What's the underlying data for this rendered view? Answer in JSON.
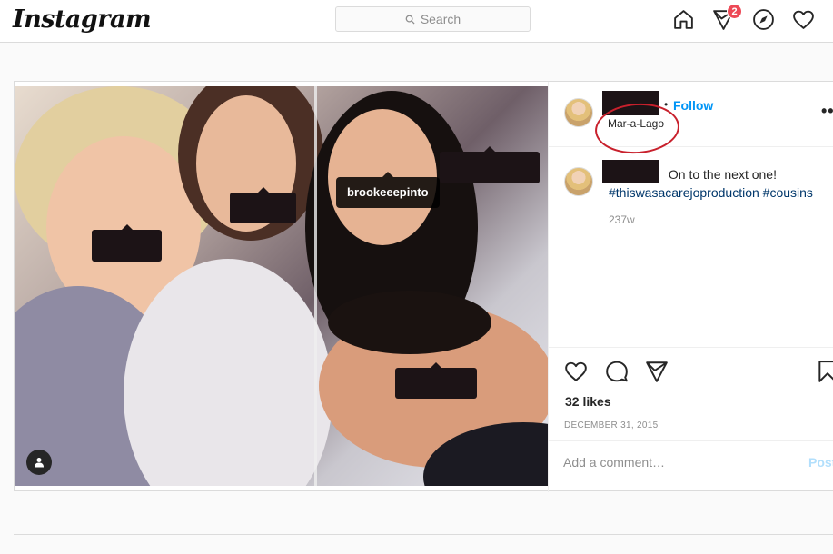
{
  "nav": {
    "logo": "Instagram",
    "search_placeholder": "Search",
    "notification_count": "2",
    "icons": [
      "home-icon",
      "direct-icon",
      "explore-icon",
      "activity-heart-icon"
    ]
  },
  "post": {
    "tagged_users": [
      {
        "label": "brookeeepinto"
      }
    ],
    "header": {
      "follow_label": "Follow",
      "separator": "•",
      "location": "Mar-a-Lago",
      "more_label": "•••"
    },
    "caption": {
      "text": "On to the next one!",
      "hashtags": "#thiswasacarejoproduction #cousins",
      "time_ago": "237w"
    },
    "likes": "32 likes",
    "date": "DECEMBER 31, 2015",
    "comment_placeholder": "Add a comment…",
    "post_button": "Post"
  },
  "colors": {
    "accent": "#0095f6",
    "hashtag": "#00376b",
    "badge": "#ed4956",
    "annotation_circle": "#c8202c"
  }
}
